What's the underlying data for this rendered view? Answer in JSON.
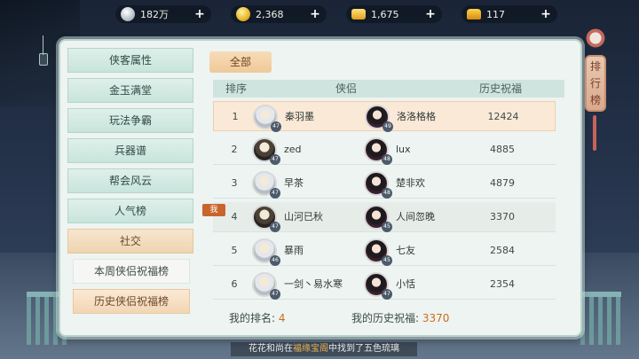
{
  "resources": [
    {
      "icon": "silver-coin-icon",
      "value": "182万"
    },
    {
      "icon": "gold-coin-icon",
      "value": "2,368"
    },
    {
      "icon": "ingot-icon",
      "value": "1,675"
    },
    {
      "icon": "gold-ingot-icon",
      "value": "117"
    }
  ],
  "sidebar": {
    "items": [
      "侠客属性",
      "金玉满堂",
      "玩法争霸",
      "兵器谱",
      "帮会风云",
      "人气榜",
      "社交"
    ],
    "active_index": 6,
    "subitems": [
      "本周侠侣祝福榜",
      "历史侠侣祝福榜"
    ],
    "active_sub_index": 1
  },
  "filter": {
    "label": "全部"
  },
  "table": {
    "headers": {
      "rank": "排序",
      "couple": "侠侣",
      "score": "历史祝福"
    },
    "rows": [
      {
        "rank": "1",
        "male": "秦羽墨",
        "male_level": "47",
        "female": "洛洛格格",
        "female_level": "49",
        "score": "12424"
      },
      {
        "rank": "2",
        "male": "zed",
        "male_level": "47",
        "female": "lux",
        "female_level": "48",
        "score": "4885"
      },
      {
        "rank": "3",
        "male": "早茶",
        "male_level": "47",
        "female": "楚非欢",
        "female_level": "48",
        "score": "4879"
      },
      {
        "rank": "4",
        "male": "山河已秋",
        "male_level": "47",
        "female": "人间忽晚",
        "female_level": "45",
        "score": "3370"
      },
      {
        "rank": "5",
        "male": "暴雨",
        "male_level": "46",
        "female": "七友",
        "female_level": "45",
        "score": "2584"
      },
      {
        "rank": "6",
        "male": "一剑丶易水寒",
        "male_level": "47",
        "female": "小恬",
        "female_level": "47",
        "score": "2354"
      }
    ],
    "me_tag": "我",
    "me_row_index": 3
  },
  "footer": {
    "my_rank_label": "我的排名:",
    "my_rank": "4",
    "my_score_label": "我的历史祝福:",
    "my_score": "3370"
  },
  "rank_banner": {
    "label": "排行榜"
  },
  "ticker": {
    "prefix": "花花和尚在",
    "highlight": "福缘宝阁",
    "suffix": "中找到了五色琉璃"
  },
  "colors": {
    "panel": "#eef4f1",
    "active_tab": "#efc998",
    "accent": "#c96d1d"
  }
}
